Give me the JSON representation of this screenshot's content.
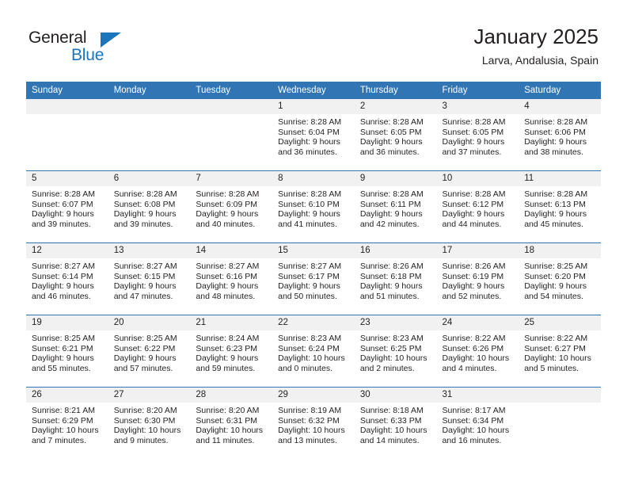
{
  "brand": {
    "name_part1": "General",
    "name_part2": "Blue",
    "triangle_icon": "triangle-icon",
    "colors": {
      "black": "#231f20",
      "blue": "#1b75bb"
    }
  },
  "header": {
    "title": "January 2025",
    "subtitle": "Larva, Andalusia, Spain"
  },
  "calendar": {
    "header_bg": "#3175b4",
    "daynum_bg": "#f1f1f1",
    "labels": {
      "sunrise": "Sunrise:",
      "sunset": "Sunset:",
      "daylight": "Daylight:"
    },
    "weekdays": [
      "Sunday",
      "Monday",
      "Tuesday",
      "Wednesday",
      "Thursday",
      "Friday",
      "Saturday"
    ],
    "weeks": [
      [
        {
          "day": "",
          "sunrise": "",
          "sunset": "",
          "daylight_line1": "",
          "daylight_line2": ""
        },
        {
          "day": "",
          "sunrise": "",
          "sunset": "",
          "daylight_line1": "",
          "daylight_line2": ""
        },
        {
          "day": "",
          "sunrise": "",
          "sunset": "",
          "daylight_line1": "",
          "daylight_line2": ""
        },
        {
          "day": "1",
          "sunrise": "Sunrise: 8:28 AM",
          "sunset": "Sunset: 6:04 PM",
          "daylight_line1": "Daylight: 9 hours",
          "daylight_line2": "and 36 minutes."
        },
        {
          "day": "2",
          "sunrise": "Sunrise: 8:28 AM",
          "sunset": "Sunset: 6:05 PM",
          "daylight_line1": "Daylight: 9 hours",
          "daylight_line2": "and 36 minutes."
        },
        {
          "day": "3",
          "sunrise": "Sunrise: 8:28 AM",
          "sunset": "Sunset: 6:05 PM",
          "daylight_line1": "Daylight: 9 hours",
          "daylight_line2": "and 37 minutes."
        },
        {
          "day": "4",
          "sunrise": "Sunrise: 8:28 AM",
          "sunset": "Sunset: 6:06 PM",
          "daylight_line1": "Daylight: 9 hours",
          "daylight_line2": "and 38 minutes."
        }
      ],
      [
        {
          "day": "5",
          "sunrise": "Sunrise: 8:28 AM",
          "sunset": "Sunset: 6:07 PM",
          "daylight_line1": "Daylight: 9 hours",
          "daylight_line2": "and 39 minutes."
        },
        {
          "day": "6",
          "sunrise": "Sunrise: 8:28 AM",
          "sunset": "Sunset: 6:08 PM",
          "daylight_line1": "Daylight: 9 hours",
          "daylight_line2": "and 39 minutes."
        },
        {
          "day": "7",
          "sunrise": "Sunrise: 8:28 AM",
          "sunset": "Sunset: 6:09 PM",
          "daylight_line1": "Daylight: 9 hours",
          "daylight_line2": "and 40 minutes."
        },
        {
          "day": "8",
          "sunrise": "Sunrise: 8:28 AM",
          "sunset": "Sunset: 6:10 PM",
          "daylight_line1": "Daylight: 9 hours",
          "daylight_line2": "and 41 minutes."
        },
        {
          "day": "9",
          "sunrise": "Sunrise: 8:28 AM",
          "sunset": "Sunset: 6:11 PM",
          "daylight_line1": "Daylight: 9 hours",
          "daylight_line2": "and 42 minutes."
        },
        {
          "day": "10",
          "sunrise": "Sunrise: 8:28 AM",
          "sunset": "Sunset: 6:12 PM",
          "daylight_line1": "Daylight: 9 hours",
          "daylight_line2": "and 44 minutes."
        },
        {
          "day": "11",
          "sunrise": "Sunrise: 8:28 AM",
          "sunset": "Sunset: 6:13 PM",
          "daylight_line1": "Daylight: 9 hours",
          "daylight_line2": "and 45 minutes."
        }
      ],
      [
        {
          "day": "12",
          "sunrise": "Sunrise: 8:27 AM",
          "sunset": "Sunset: 6:14 PM",
          "daylight_line1": "Daylight: 9 hours",
          "daylight_line2": "and 46 minutes."
        },
        {
          "day": "13",
          "sunrise": "Sunrise: 8:27 AM",
          "sunset": "Sunset: 6:15 PM",
          "daylight_line1": "Daylight: 9 hours",
          "daylight_line2": "and 47 minutes."
        },
        {
          "day": "14",
          "sunrise": "Sunrise: 8:27 AM",
          "sunset": "Sunset: 6:16 PM",
          "daylight_line1": "Daylight: 9 hours",
          "daylight_line2": "and 48 minutes."
        },
        {
          "day": "15",
          "sunrise": "Sunrise: 8:27 AM",
          "sunset": "Sunset: 6:17 PM",
          "daylight_line1": "Daylight: 9 hours",
          "daylight_line2": "and 50 minutes."
        },
        {
          "day": "16",
          "sunrise": "Sunrise: 8:26 AM",
          "sunset": "Sunset: 6:18 PM",
          "daylight_line1": "Daylight: 9 hours",
          "daylight_line2": "and 51 minutes."
        },
        {
          "day": "17",
          "sunrise": "Sunrise: 8:26 AM",
          "sunset": "Sunset: 6:19 PM",
          "daylight_line1": "Daylight: 9 hours",
          "daylight_line2": "and 52 minutes."
        },
        {
          "day": "18",
          "sunrise": "Sunrise: 8:25 AM",
          "sunset": "Sunset: 6:20 PM",
          "daylight_line1": "Daylight: 9 hours",
          "daylight_line2": "and 54 minutes."
        }
      ],
      [
        {
          "day": "19",
          "sunrise": "Sunrise: 8:25 AM",
          "sunset": "Sunset: 6:21 PM",
          "daylight_line1": "Daylight: 9 hours",
          "daylight_line2": "and 55 minutes."
        },
        {
          "day": "20",
          "sunrise": "Sunrise: 8:25 AM",
          "sunset": "Sunset: 6:22 PM",
          "daylight_line1": "Daylight: 9 hours",
          "daylight_line2": "and 57 minutes."
        },
        {
          "day": "21",
          "sunrise": "Sunrise: 8:24 AM",
          "sunset": "Sunset: 6:23 PM",
          "daylight_line1": "Daylight: 9 hours",
          "daylight_line2": "and 59 minutes."
        },
        {
          "day": "22",
          "sunrise": "Sunrise: 8:23 AM",
          "sunset": "Sunset: 6:24 PM",
          "daylight_line1": "Daylight: 10 hours",
          "daylight_line2": "and 0 minutes."
        },
        {
          "day": "23",
          "sunrise": "Sunrise: 8:23 AM",
          "sunset": "Sunset: 6:25 PM",
          "daylight_line1": "Daylight: 10 hours",
          "daylight_line2": "and 2 minutes."
        },
        {
          "day": "24",
          "sunrise": "Sunrise: 8:22 AM",
          "sunset": "Sunset: 6:26 PM",
          "daylight_line1": "Daylight: 10 hours",
          "daylight_line2": "and 4 minutes."
        },
        {
          "day": "25",
          "sunrise": "Sunrise: 8:22 AM",
          "sunset": "Sunset: 6:27 PM",
          "daylight_line1": "Daylight: 10 hours",
          "daylight_line2": "and 5 minutes."
        }
      ],
      [
        {
          "day": "26",
          "sunrise": "Sunrise: 8:21 AM",
          "sunset": "Sunset: 6:29 PM",
          "daylight_line1": "Daylight: 10 hours",
          "daylight_line2": "and 7 minutes."
        },
        {
          "day": "27",
          "sunrise": "Sunrise: 8:20 AM",
          "sunset": "Sunset: 6:30 PM",
          "daylight_line1": "Daylight: 10 hours",
          "daylight_line2": "and 9 minutes."
        },
        {
          "day": "28",
          "sunrise": "Sunrise: 8:20 AM",
          "sunset": "Sunset: 6:31 PM",
          "daylight_line1": "Daylight: 10 hours",
          "daylight_line2": "and 11 minutes."
        },
        {
          "day": "29",
          "sunrise": "Sunrise: 8:19 AM",
          "sunset": "Sunset: 6:32 PM",
          "daylight_line1": "Daylight: 10 hours",
          "daylight_line2": "and 13 minutes."
        },
        {
          "day": "30",
          "sunrise": "Sunrise: 8:18 AM",
          "sunset": "Sunset: 6:33 PM",
          "daylight_line1": "Daylight: 10 hours",
          "daylight_line2": "and 14 minutes."
        },
        {
          "day": "31",
          "sunrise": "Sunrise: 8:17 AM",
          "sunset": "Sunset: 6:34 PM",
          "daylight_line1": "Daylight: 10 hours",
          "daylight_line2": "and 16 minutes."
        },
        {
          "day": "",
          "sunrise": "",
          "sunset": "",
          "daylight_line1": "",
          "daylight_line2": ""
        }
      ]
    ]
  }
}
